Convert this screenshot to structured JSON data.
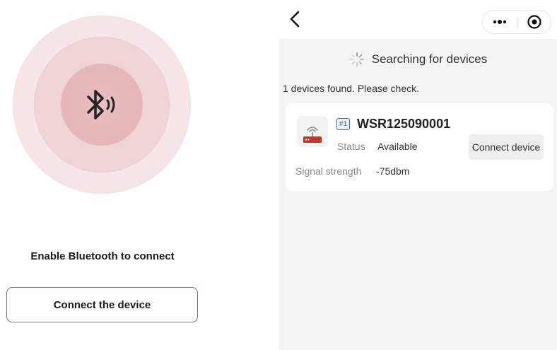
{
  "left": {
    "bluetooth_icon": "bluetooth-icon",
    "enable_label": "Enable Bluetooth to connect",
    "connect_button_label": "Connect the device"
  },
  "nav": {
    "back_icon": "chevron-left-icon",
    "more_icon": "more-dots-icon",
    "target_icon": "target-icon"
  },
  "search": {
    "status_text": "Searching for devices",
    "found_text": "1 devices found. Please check."
  },
  "devices": [
    {
      "icon": "router-icon",
      "index": "#1",
      "name": "WSR125090001",
      "status_label": "Status",
      "status_value": "Available",
      "connect_label": "Connect device",
      "signal_label": "Signal strength",
      "signal_value": "-75dbm"
    }
  ],
  "colors": {
    "accent_pink": "#e4b3b8",
    "badge_blue": "#3b6fb6",
    "router_red": "#c0392b"
  }
}
